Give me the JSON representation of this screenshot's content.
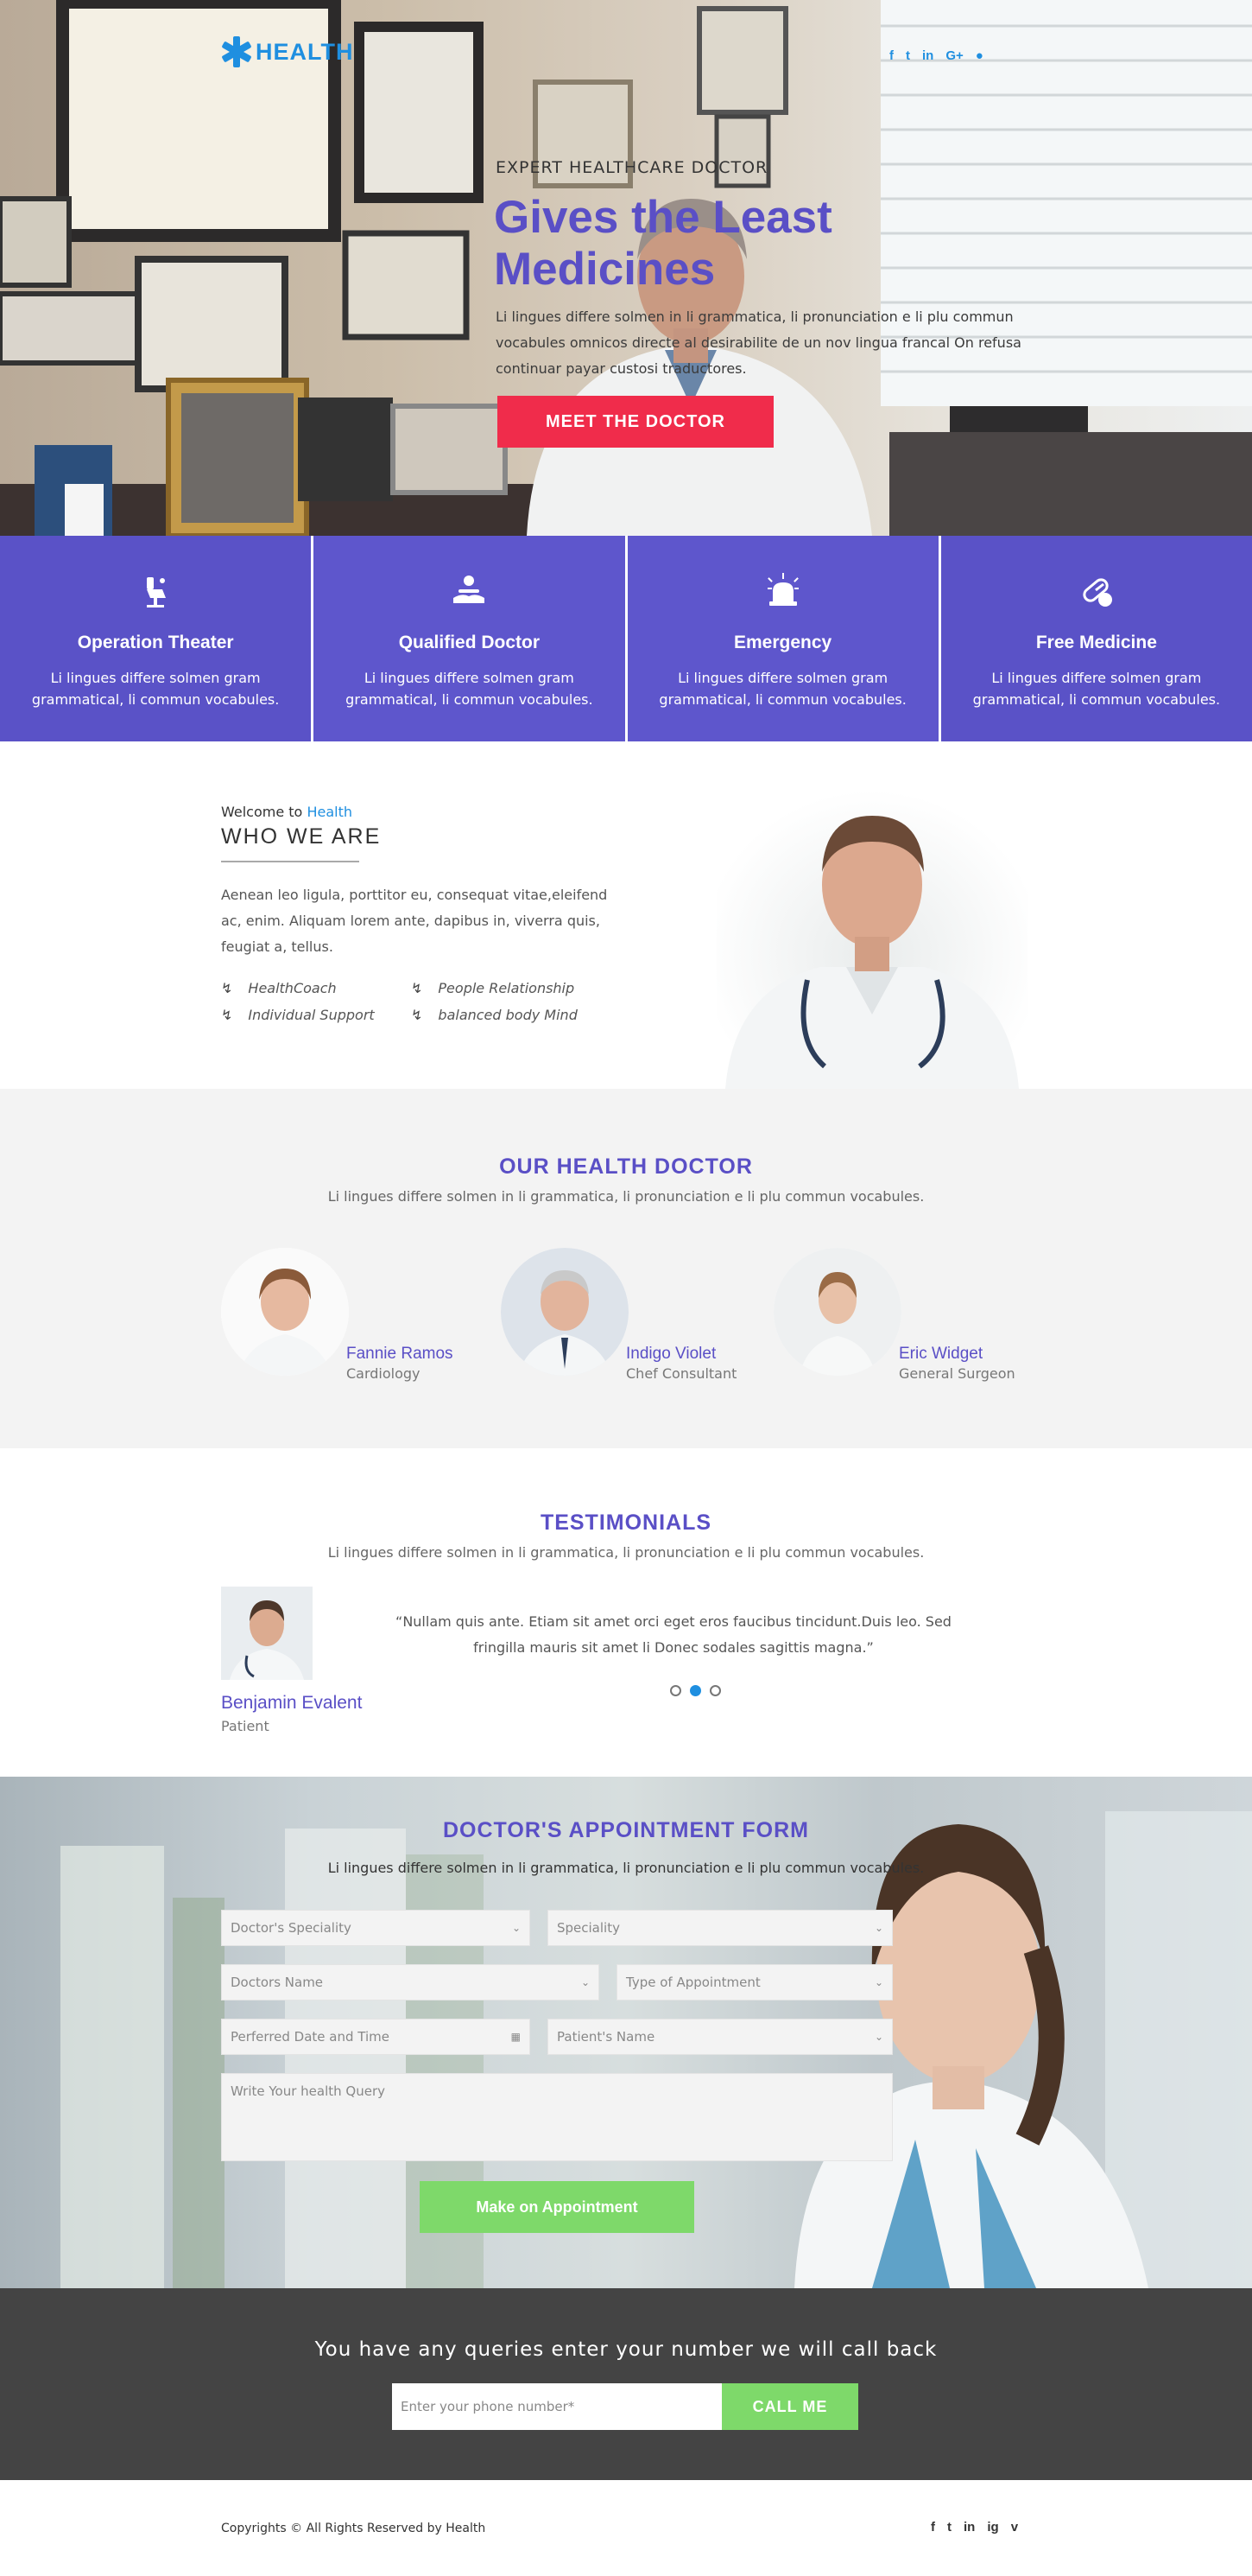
{
  "brand": {
    "name": "HEALTH",
    "accent": "#5a4fc6",
    "link": "#1f8fe0",
    "cta": "#f02c4b",
    "green": "#7ed96a"
  },
  "hero": {
    "social": [
      "f",
      "t",
      "in",
      "G+",
      "globe-icon"
    ],
    "eyebrow": "EXPERT HEALTHCARE DOCTOR",
    "title": "Gives the Least Medicines",
    "text": "Li lingues differe solmen in li grammatica, li pronunciation e li plu commun vocabules omnicos directe al desirabilite de un nov lingua francal On refusa continuar payar custosi traductores.",
    "cta": "MEET THE DOCTOR"
  },
  "features": [
    {
      "icon": "dental-chair-icon",
      "title": "Operation Theater",
      "text": "Li lingues differe solmen gram grammatical, li commun vocabules."
    },
    {
      "icon": "hand-care-icon",
      "title": "Qualified Doctor",
      "text": "Li lingues differe solmen gram grammatical, li commun vocabules."
    },
    {
      "icon": "siren-icon",
      "title": "Emergency",
      "text": "Li lingues differe solmen gram grammatical, li commun vocabules."
    },
    {
      "icon": "pill-icon",
      "title": "Free Medicine",
      "text": "Li lingues differe solmen gram grammatical, li commun vocabules."
    }
  ],
  "about": {
    "welcome_prefix": "Welcome to",
    "welcome_brand": "Health",
    "title": "WHO WE ARE",
    "text": "Aenean leo ligula, porttitor eu, consequat vitae,eleifend ac, enim. Aliquam lorem ante, dapibus in, viverra quis, feugiat a, tellus.",
    "points": [
      "HealthCoach",
      "People Relationship",
      "Individual Support",
      "balanced body Mind"
    ]
  },
  "doctors": {
    "title": "OUR HEALTH DOCTOR",
    "subtitle": "Li lingues differe solmen in li grammatica, li pronunciation e li plu commun vocabules.",
    "items": [
      {
        "name": "Fannie Ramos",
        "role": "Cardiology"
      },
      {
        "name": "Indigo Violet",
        "role": "Chef Consultant"
      },
      {
        "name": "Eric Widget",
        "role": "General Surgeon"
      }
    ]
  },
  "testimonials": {
    "title": "TESTIMONIALS",
    "subtitle": "Li lingues differe solmen in li grammatica, li pronunciation e li plu commun vocabules.",
    "name": "Benjamin Evalent",
    "role": "Patient",
    "quote": "“Nullam quis ante. Etiam sit amet orci eget eros faucibus tincidunt.Duis leo. Sed fringilla mauris sit amet li Donec sodales sagittis magna.”",
    "active_slide": 2,
    "slide_count": 3
  },
  "appointment": {
    "title": "DOCTOR'S  APPOINTMENT FORM",
    "subtitle": "Li lingues differe solmen in li grammatica, li pronunciation e li plu commun vocabules.",
    "fields": {
      "speciality1": "Doctor's Speciality",
      "speciality2": "Speciality",
      "doctor_name": "Doctors Name",
      "appt_type": "Type of Appointment",
      "date": "Perferred Date and Time",
      "patient": "Patient's Name",
      "query": "Write Your health Query"
    },
    "submit": "Make on Appointment"
  },
  "callback": {
    "message": "You have any queries enter your number we will call back",
    "placeholder": "Enter your phone number*",
    "button": "CALL ME"
  },
  "footer": {
    "copyright": "Copyrights © All Rights Reserved by Health",
    "social": [
      "f",
      "t",
      "in",
      "ig",
      "v"
    ]
  }
}
